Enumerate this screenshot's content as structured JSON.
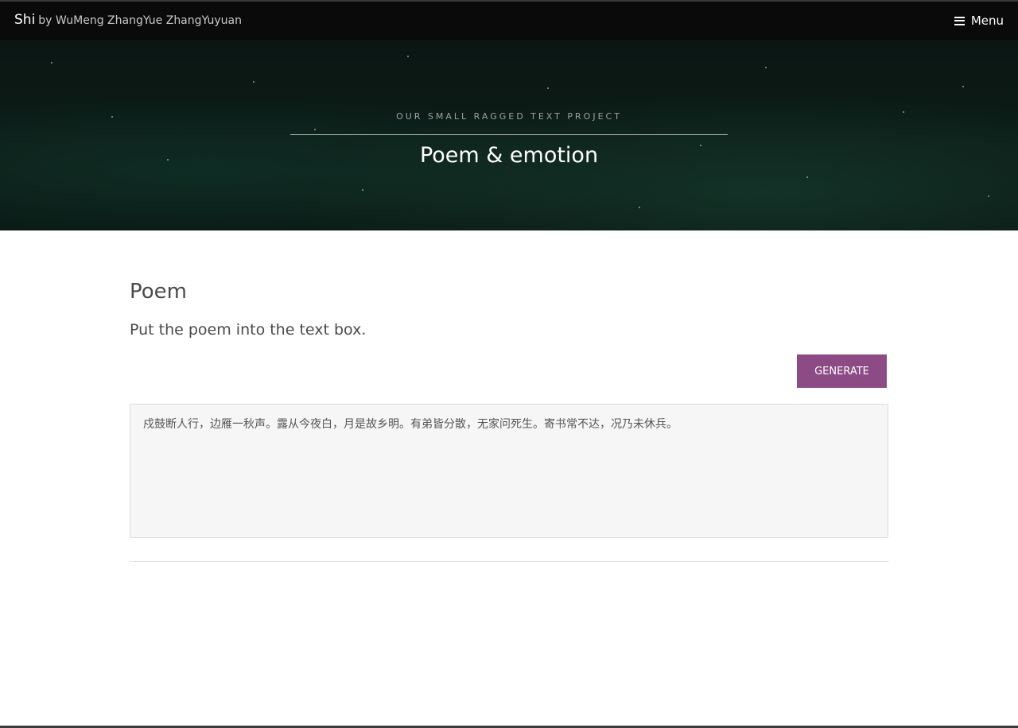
{
  "header": {
    "brand": "Shi",
    "authors": "by WuMeng ZhangYue ZhangYuyuan",
    "menu_label": "Menu",
    "menu_icon": "hamburger-icon"
  },
  "banner": {
    "subtitle": "OUR SMALL RAGGED TEXT PROJECT",
    "title": "Poem & emotion"
  },
  "main": {
    "section_title": "Poem",
    "instruction": "Put the poem into the text box.",
    "generate_label": "GENERATE",
    "poem_value": "戍鼓断人行，边雁一秋声。露从今夜白，月是故乡明。有弟皆分散，无家问死生。寄书常不达，况乃未休兵。"
  },
  "colors": {
    "navbar": "#0a0a0a",
    "accent_button": "#8d4b85",
    "banner_bg": "#0c1d18",
    "text_box_bg": "#f6f6f6"
  }
}
